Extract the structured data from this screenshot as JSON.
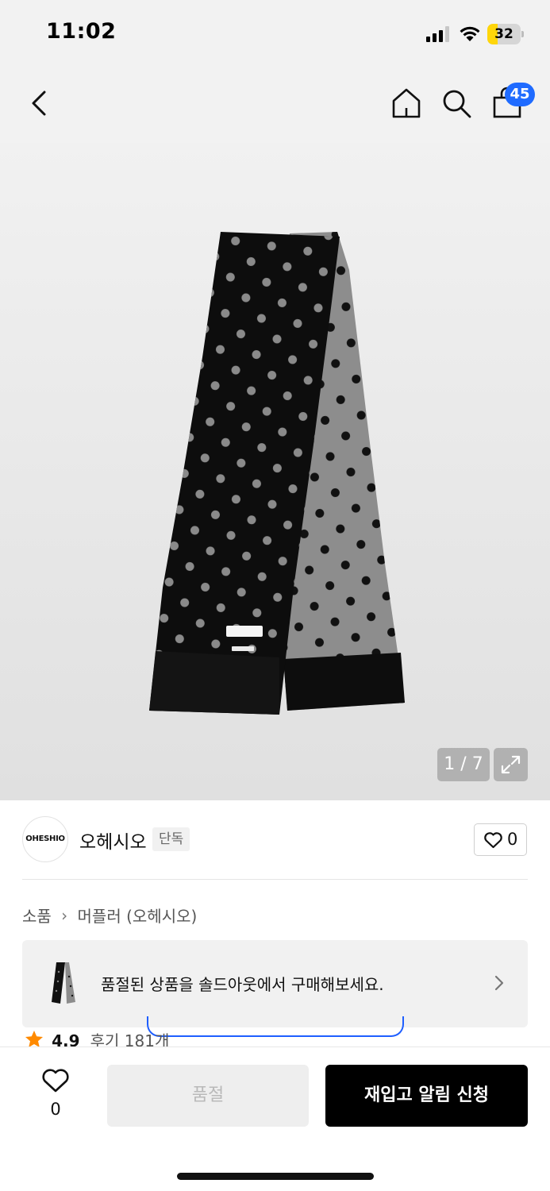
{
  "status_bar": {
    "time": "11:02",
    "battery": "32",
    "battery_level": 0.32
  },
  "header": {
    "cart_count": "45"
  },
  "gallery": {
    "counter": "1 / 7"
  },
  "brand": {
    "logo_text": "OHESHIO",
    "name": "오헤시오",
    "badge": "단독",
    "like_count": "0"
  },
  "breadcrumb": {
    "items": [
      "소품",
      "머플러 (오헤시오)"
    ]
  },
  "soldout_banner": {
    "text": "품절된 상품을 솔드아웃에서 구매해보세요."
  },
  "rating": {
    "value": "4.9",
    "reviews": "후기 181개"
  },
  "bottom_bar": {
    "wish_count": "0",
    "soldout_label": "품절",
    "restock_label": "재입고 알림 신청"
  },
  "colors": {
    "accent": "#1f6bff",
    "primary_button": "#000000",
    "battery": "#ffd60a",
    "star": "#ff8a00"
  }
}
